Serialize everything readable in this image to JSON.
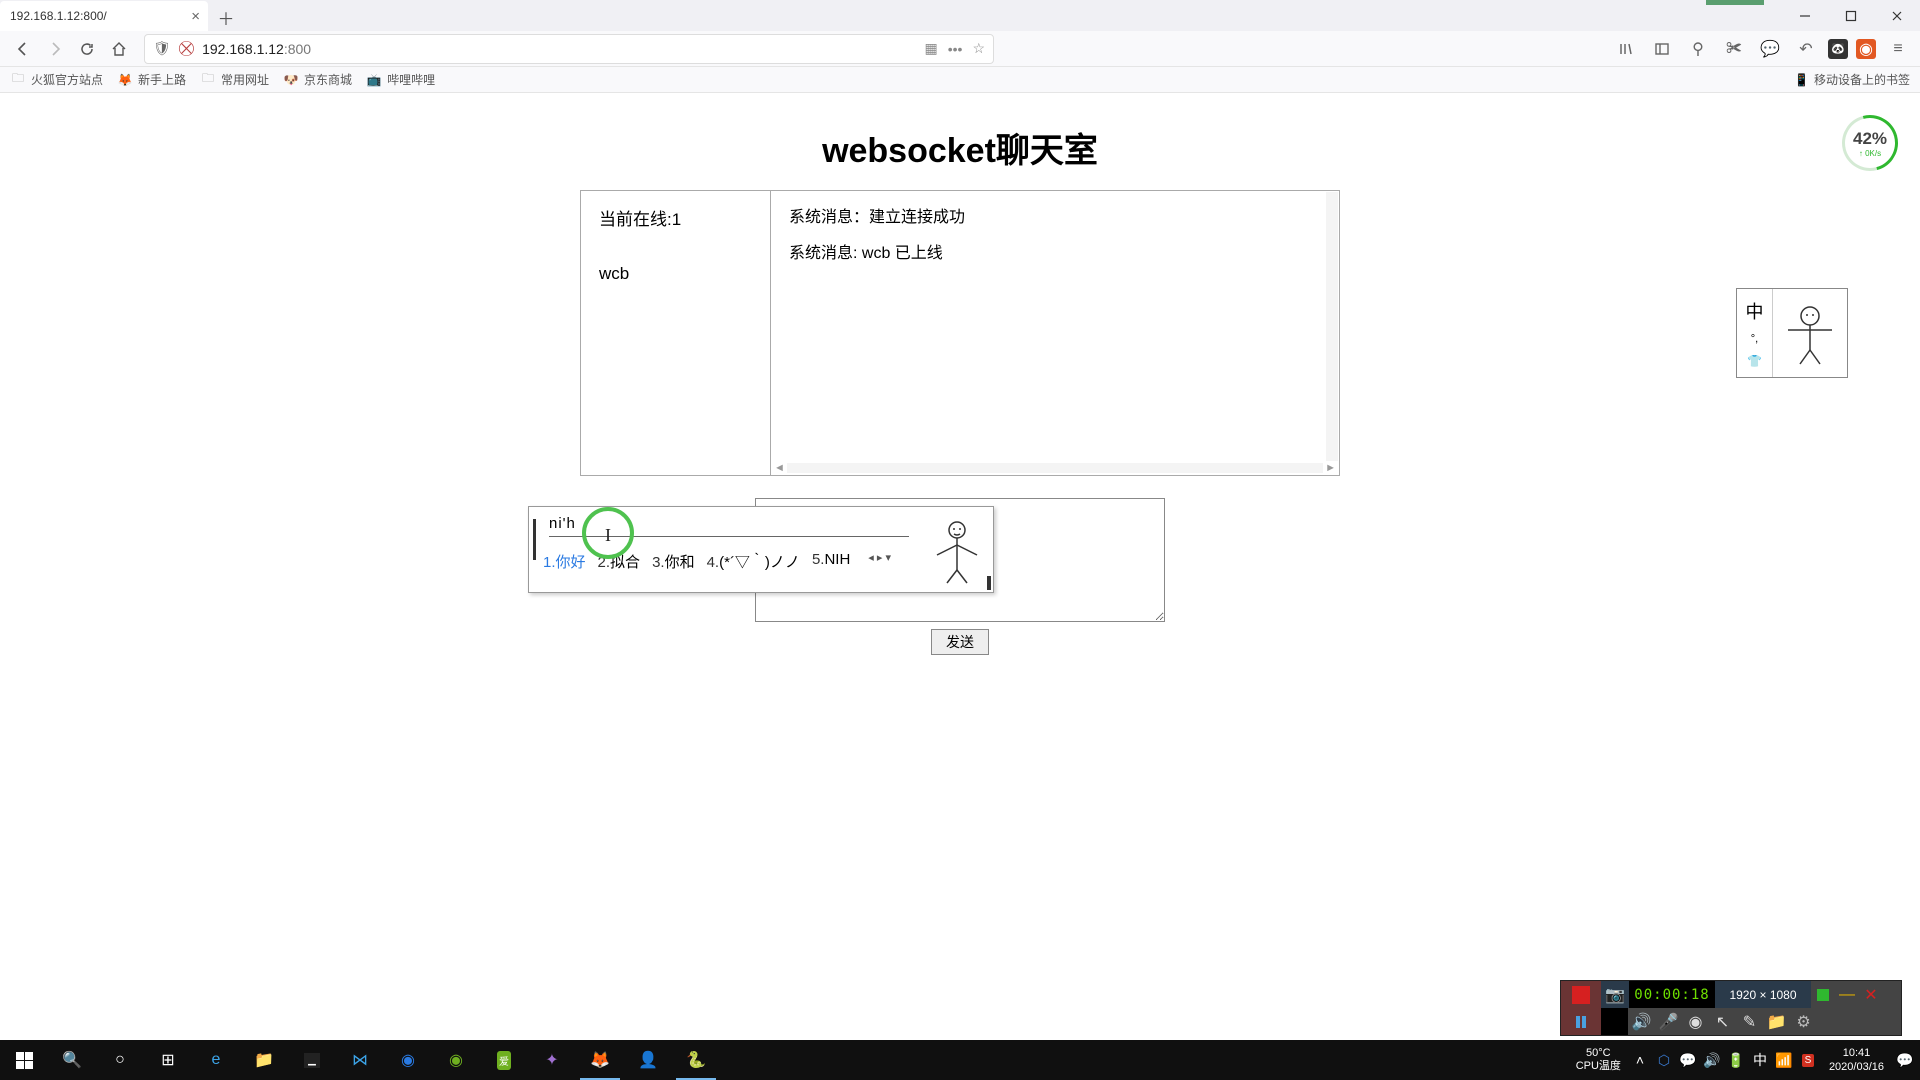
{
  "browser": {
    "tab_title": "192.168.1.12:800/",
    "url_host": "192.168.1.12",
    "url_port": ":800",
    "bookmarks": {
      "b1": "火狐官方站点",
      "b2": "新手上路",
      "b3": "常用网址",
      "b4": "京东商城",
      "b5": "哔哩哔哩",
      "mobile": "移动设备上的书签"
    }
  },
  "page": {
    "title": "websocket聊天室",
    "online_label": "当前在线:1",
    "online_user": "wcb",
    "msg1": "系统消息：建立连接成功",
    "msg2": "系统消息: wcb 已上线",
    "send": "发送"
  },
  "ime": {
    "input": "ni'h",
    "c1n": "1.",
    "c1w": "你好",
    "c2n": "2.",
    "c2w": "拟合",
    "c3n": "3.",
    "c3w": "你和",
    "c4n": "4.",
    "c4w": "(*´▽｀)ノノ",
    "c5n": "5.",
    "c5w": "NIH",
    "float_mode": "中",
    "float_punct": "°,"
  },
  "widget": {
    "pct": "42%",
    "speed": "↑ 0K/s"
  },
  "recorder": {
    "timer": "00:00:18",
    "dims": "1920 × 1080"
  },
  "tray": {
    "temp": "50°C",
    "temp_label": "CPU温度",
    "zh": "中",
    "time": "10:41",
    "date": "2020/03/16"
  }
}
